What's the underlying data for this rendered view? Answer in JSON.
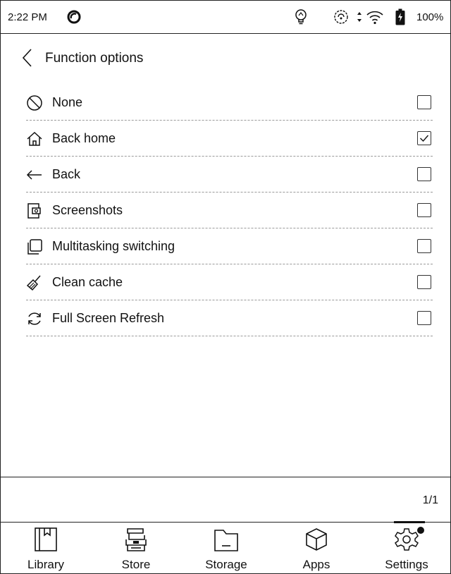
{
  "status_bar": {
    "time": "2:22 PM",
    "battery": "100%",
    "icons": [
      "ring-icon",
      "bulb-icon",
      "sync-icon",
      "arrows-icon",
      "wifi-icon",
      "battery-icon"
    ]
  },
  "header": {
    "title": "Function options",
    "back_icon": "chevron-left-icon"
  },
  "options": [
    {
      "label": "None",
      "icon": "none-icon",
      "checked": false
    },
    {
      "label": "Back home",
      "icon": "home-icon",
      "checked": true
    },
    {
      "label": "Back",
      "icon": "arrow-left-icon",
      "checked": false
    },
    {
      "label": "Screenshots",
      "icon": "screenshot-icon",
      "checked": false
    },
    {
      "label": "Multitasking switching",
      "icon": "multitask-icon",
      "checked": false
    },
    {
      "label": "Clean cache",
      "icon": "broom-icon",
      "checked": false
    },
    {
      "label": "Full Screen Refresh",
      "icon": "refresh-icon",
      "checked": false
    }
  ],
  "pager": {
    "text": "1/1"
  },
  "nav": {
    "items": [
      {
        "label": "Library",
        "icon": "library-icon"
      },
      {
        "label": "Store",
        "icon": "store-icon"
      },
      {
        "label": "Storage",
        "icon": "folder-icon"
      },
      {
        "label": "Apps",
        "icon": "cube-icon"
      },
      {
        "label": "Settings",
        "icon": "gear-icon"
      }
    ],
    "active": "Settings"
  }
}
